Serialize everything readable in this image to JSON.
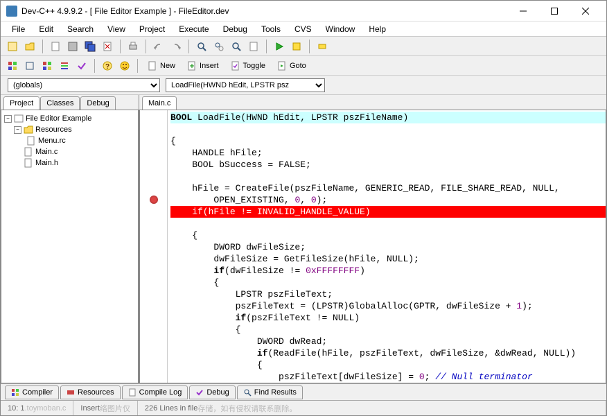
{
  "window": {
    "title": "Dev-C++ 4.9.9.2  -  [ File Editor Example ]  - FileEditor.dev"
  },
  "menu": {
    "items": [
      "File",
      "Edit",
      "Search",
      "View",
      "Project",
      "Execute",
      "Debug",
      "Tools",
      "CVS",
      "Window",
      "Help"
    ]
  },
  "toolbar2": {
    "new": "New",
    "insert": "Insert",
    "toggle": "Toggle",
    "goto": "Goto"
  },
  "dropdowns": {
    "scope": "(globals)",
    "func": "LoadFile(HWND hEdit, LPSTR psz"
  },
  "projectTabs": [
    "Project",
    "Classes",
    "Debug"
  ],
  "tree": {
    "root": "File Editor Example",
    "resources": "Resources",
    "items": [
      "Menu.rc",
      "Main.c",
      "Main.h"
    ]
  },
  "fileTabs": [
    "Main.c"
  ],
  "code": {
    "l1": "BOOL LoadFile(HWND hEdit, LPSTR pszFileName)",
    "l2": "{",
    "l3": "    HANDLE hFile;",
    "l4": "    BOOL bSuccess = FALSE;",
    "l5": "",
    "l6": "    hFile = CreateFile(pszFileName, GENERIC_READ, FILE_SHARE_READ, NULL,",
    "l7": "        OPEN_EXISTING, 0, 0);",
    "l8": "    if(hFile != INVALID_HANDLE_VALUE)",
    "l9": "    {",
    "l10": "        DWORD dwFileSize;",
    "l11": "        dwFileSize = GetFileSize(hFile, NULL);",
    "l12": "        if(dwFileSize != 0xFFFFFFFF)",
    "l13": "        {",
    "l14": "            LPSTR pszFileText;",
    "l15": "            pszFileText = (LPSTR)GlobalAlloc(GPTR, dwFileSize + 1);",
    "l16": "            if(pszFileText != NULL)",
    "l17": "            {",
    "l18": "                DWORD dwRead;",
    "l19": "                if(ReadFile(hFile, pszFileText, dwFileSize, &dwRead, NULL))",
    "l20": "                {",
    "l21": "                    pszFileText[dwFileSize] = 0; // Null terminator"
  },
  "bottomTabs": [
    "Compiler",
    "Resources",
    "Compile Log",
    "Debug",
    "Find Results"
  ],
  "status": {
    "pos": "10: 1",
    "faded1": ".toymoban.c",
    "mode": "Insert",
    "faded2": "络图片仅",
    "lines": "226 Lines in file",
    "faded3": "存储，如有侵权请联系删除。"
  }
}
